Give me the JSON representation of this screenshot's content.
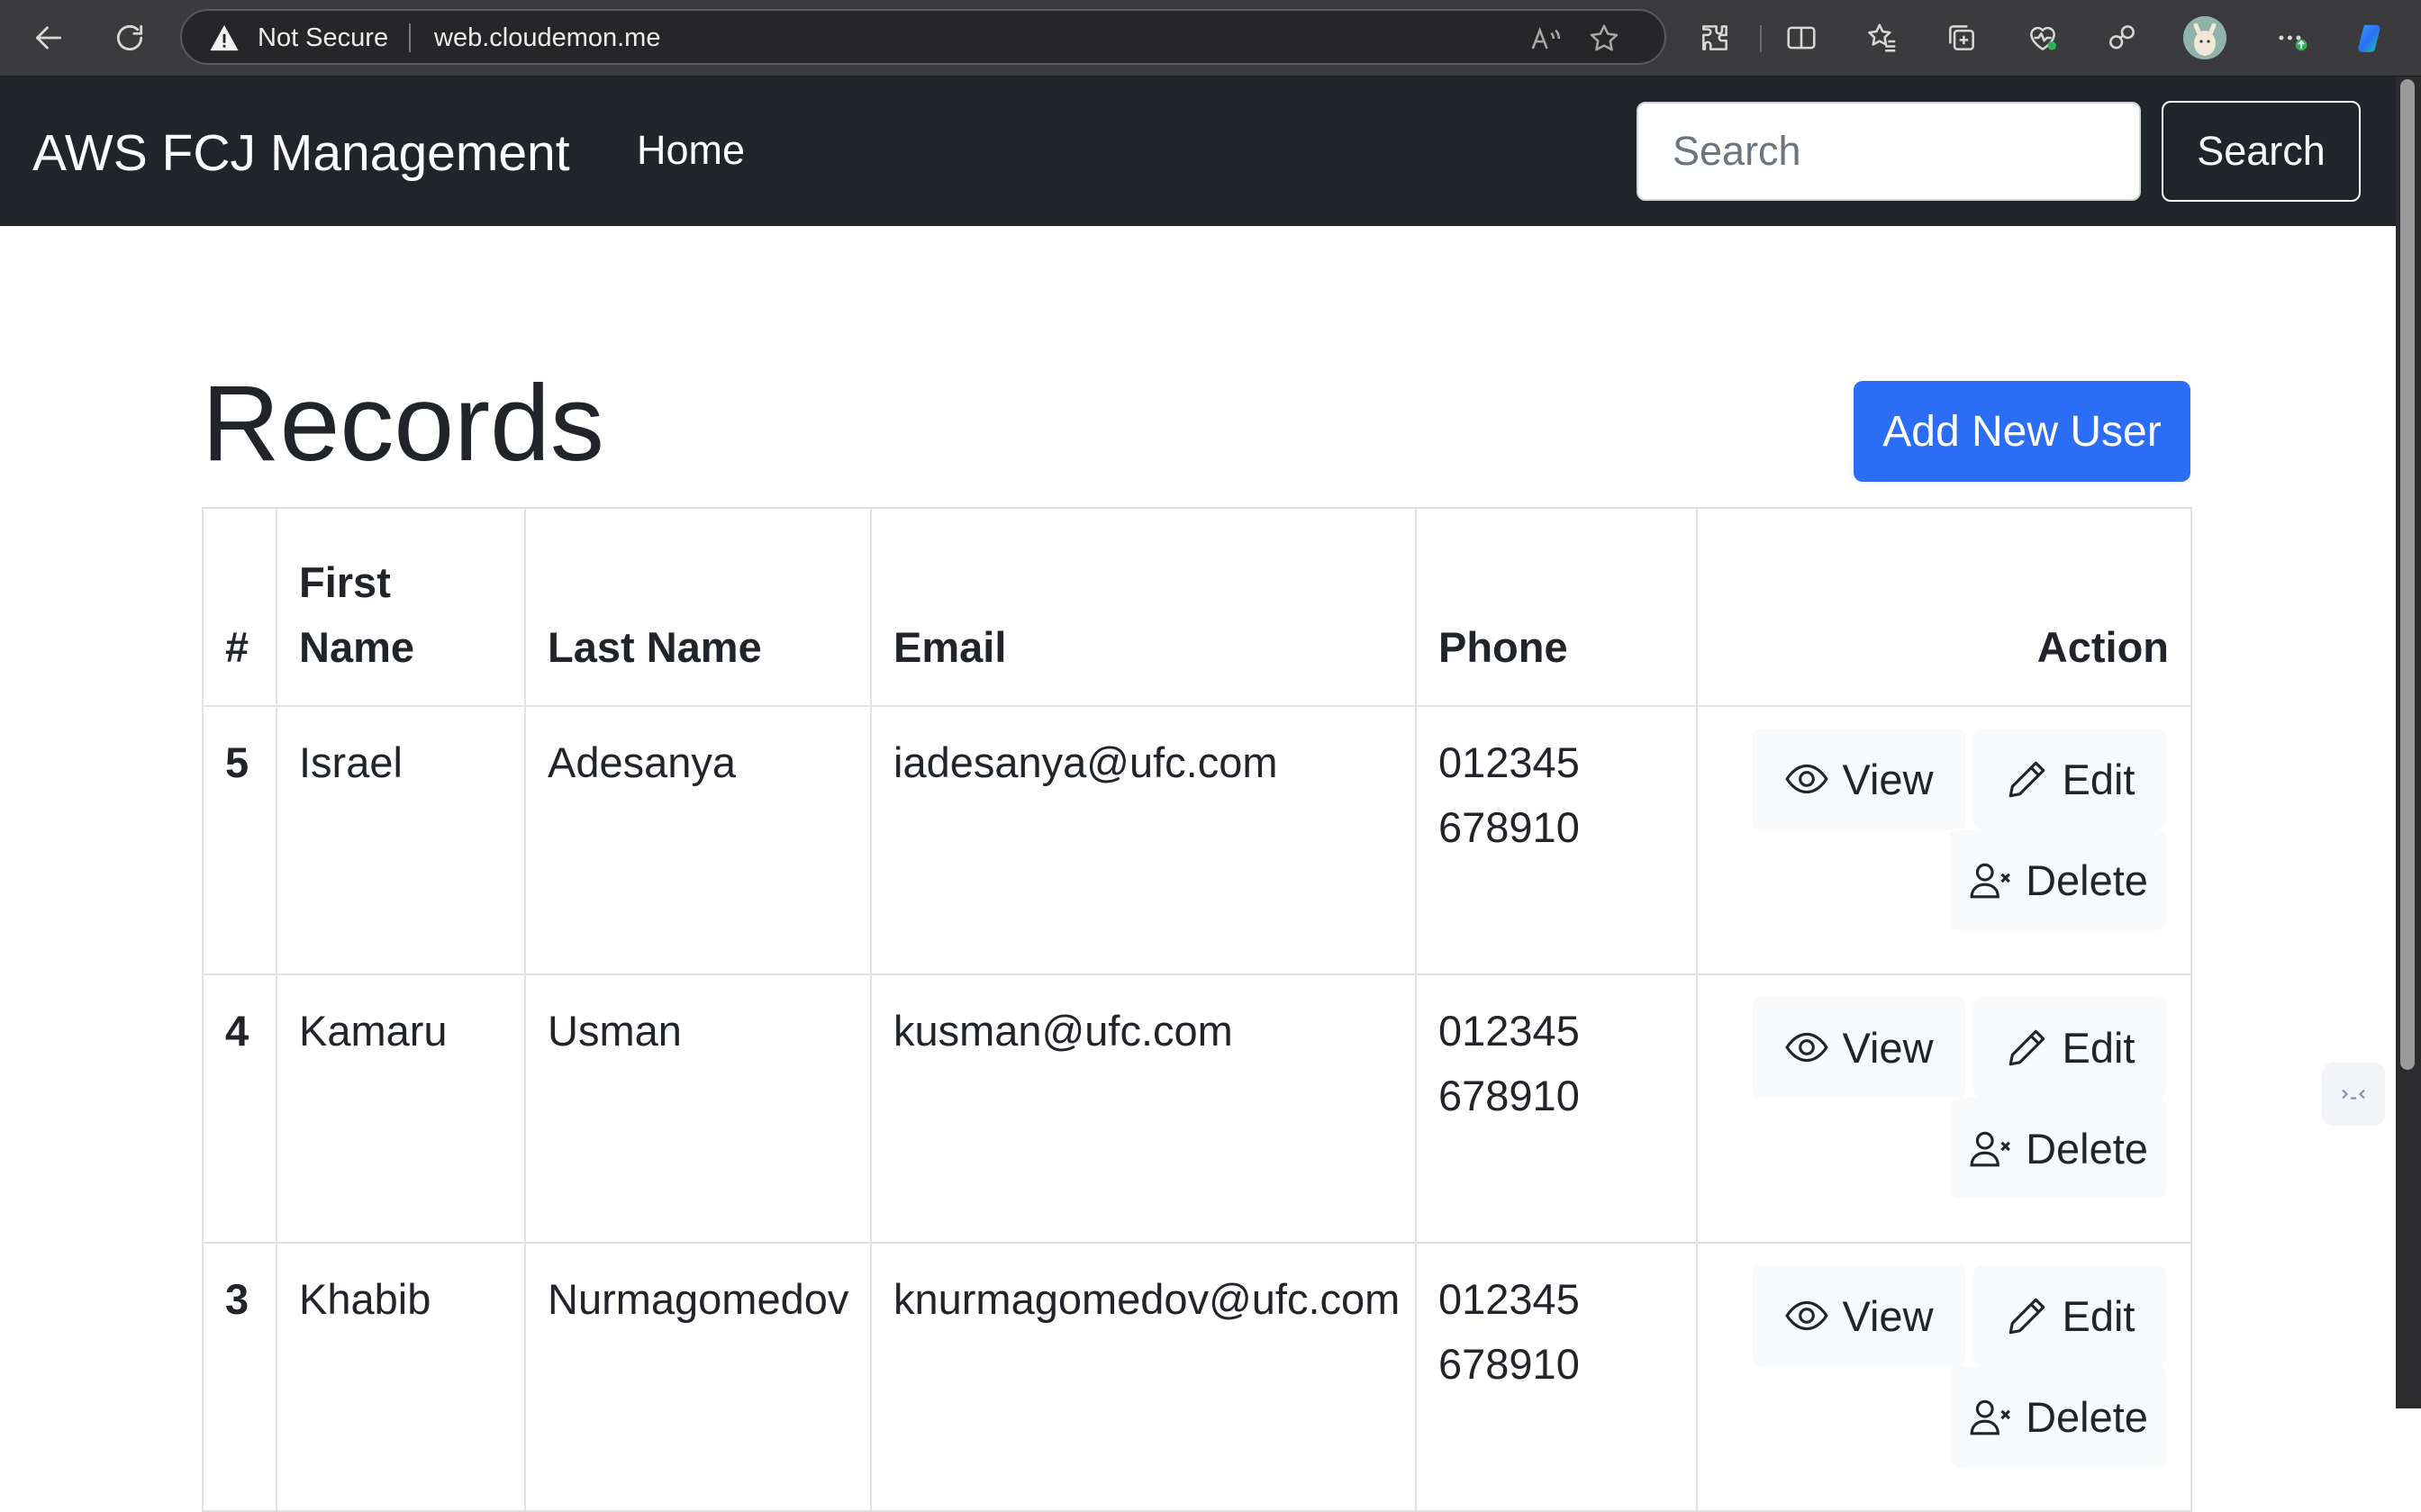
{
  "browser": {
    "security_label": "Not Secure",
    "url": "web.cloudemon.me"
  },
  "navbar": {
    "brand": "AWS FCJ Management",
    "home_label": "Home",
    "search_placeholder": "Search",
    "search_button": "Search"
  },
  "page": {
    "title": "Records",
    "add_button": "Add New User"
  },
  "table": {
    "headers": {
      "id": "#",
      "first_name": "First Name",
      "last_name": "Last Name",
      "email": "Email",
      "phone": "Phone",
      "action": "Action"
    },
    "actions": {
      "view": "View",
      "edit": "Edit",
      "delete": "Delete"
    },
    "rows": [
      {
        "id": "5",
        "first_name": "Israel",
        "last_name": "Adesanya",
        "email": "iadesanya@ufc.com",
        "phone": "012345 678910"
      },
      {
        "id": "4",
        "first_name": "Kamaru",
        "last_name": "Usman",
        "email": "kusman@ufc.com",
        "phone": "012345 678910"
      },
      {
        "id": "3",
        "first_name": "Khabib",
        "last_name": "Nurmagomedov",
        "email": "knurmagomedov@ufc.com",
        "phone": "012345 678910"
      }
    ]
  },
  "colors": {
    "navbar_bg": "#212529",
    "primary": "#2b6ef5",
    "chrome_bg": "#3b3b3d"
  }
}
